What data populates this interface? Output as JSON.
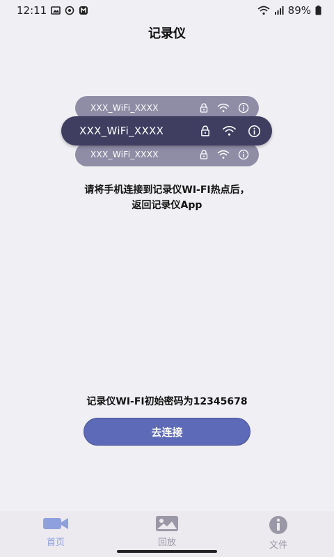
{
  "status_bar": {
    "time": "12:11",
    "battery": "89%",
    "left_icons": [
      "image-icon",
      "record-icon",
      "app-icon"
    ],
    "right_icons": [
      "wifi-icon",
      "signal-icon",
      "battery-icon"
    ]
  },
  "header": {
    "title": "记录仪"
  },
  "wifi_list": {
    "items": [
      {
        "ssid": "XXX_WiFi_XXXX",
        "icons": [
          "lock-icon",
          "wifi-icon",
          "info-icon"
        ]
      },
      {
        "ssid": "XXX_WiFi_XXXX",
        "icons": [
          "lock-icon",
          "wifi-icon",
          "info-icon"
        ]
      },
      {
        "ssid": "XXX_WiFi_XXXX",
        "icons": [
          "lock-icon",
          "wifi-icon",
          "info-icon"
        ]
      }
    ]
  },
  "instruction": {
    "line1": "请将手机连接到记录仪WI-FI热点后，",
    "line2": "返回记录仪App"
  },
  "password_note": "记录仪WI-FI初始密码为12345678",
  "connect_button": {
    "label": "去连接"
  },
  "bottom_nav": {
    "items": [
      {
        "label": "首页",
        "icon": "camera-icon",
        "active": true
      },
      {
        "label": "回放",
        "icon": "gallery-icon",
        "active": false
      },
      {
        "label": "文件",
        "icon": "info-icon",
        "active": false
      }
    ]
  },
  "colors": {
    "background": "#f0eff4",
    "card_back": "#8f8da6",
    "card_front": "#3f3e61",
    "button": "#5d6ab8",
    "nav_active": "#8fa0de",
    "nav_inactive": "#9a98a6"
  }
}
